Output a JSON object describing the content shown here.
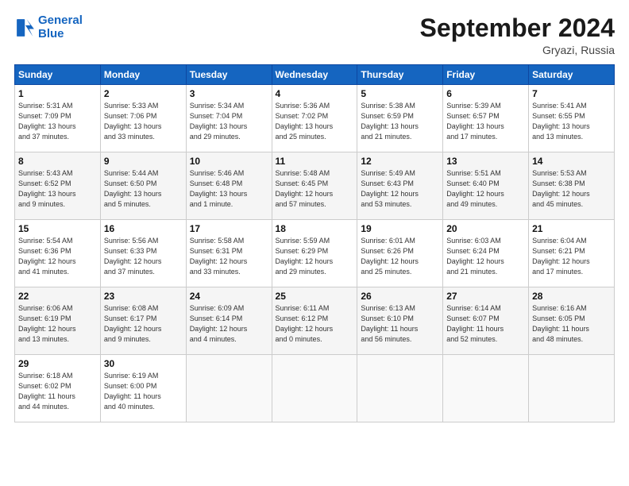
{
  "header": {
    "logo_line1": "General",
    "logo_line2": "Blue",
    "month": "September 2024",
    "location": "Gryazi, Russia"
  },
  "days_of_week": [
    "Sunday",
    "Monday",
    "Tuesday",
    "Wednesday",
    "Thursday",
    "Friday",
    "Saturday"
  ],
  "weeks": [
    [
      {
        "day": "1",
        "info": "Sunrise: 5:31 AM\nSunset: 7:09 PM\nDaylight: 13 hours\nand 37 minutes."
      },
      {
        "day": "2",
        "info": "Sunrise: 5:33 AM\nSunset: 7:06 PM\nDaylight: 13 hours\nand 33 minutes."
      },
      {
        "day": "3",
        "info": "Sunrise: 5:34 AM\nSunset: 7:04 PM\nDaylight: 13 hours\nand 29 minutes."
      },
      {
        "day": "4",
        "info": "Sunrise: 5:36 AM\nSunset: 7:02 PM\nDaylight: 13 hours\nand 25 minutes."
      },
      {
        "day": "5",
        "info": "Sunrise: 5:38 AM\nSunset: 6:59 PM\nDaylight: 13 hours\nand 21 minutes."
      },
      {
        "day": "6",
        "info": "Sunrise: 5:39 AM\nSunset: 6:57 PM\nDaylight: 13 hours\nand 17 minutes."
      },
      {
        "day": "7",
        "info": "Sunrise: 5:41 AM\nSunset: 6:55 PM\nDaylight: 13 hours\nand 13 minutes."
      }
    ],
    [
      {
        "day": "8",
        "info": "Sunrise: 5:43 AM\nSunset: 6:52 PM\nDaylight: 13 hours\nand 9 minutes."
      },
      {
        "day": "9",
        "info": "Sunrise: 5:44 AM\nSunset: 6:50 PM\nDaylight: 13 hours\nand 5 minutes."
      },
      {
        "day": "10",
        "info": "Sunrise: 5:46 AM\nSunset: 6:48 PM\nDaylight: 13 hours\nand 1 minute."
      },
      {
        "day": "11",
        "info": "Sunrise: 5:48 AM\nSunset: 6:45 PM\nDaylight: 12 hours\nand 57 minutes."
      },
      {
        "day": "12",
        "info": "Sunrise: 5:49 AM\nSunset: 6:43 PM\nDaylight: 12 hours\nand 53 minutes."
      },
      {
        "day": "13",
        "info": "Sunrise: 5:51 AM\nSunset: 6:40 PM\nDaylight: 12 hours\nand 49 minutes."
      },
      {
        "day": "14",
        "info": "Sunrise: 5:53 AM\nSunset: 6:38 PM\nDaylight: 12 hours\nand 45 minutes."
      }
    ],
    [
      {
        "day": "15",
        "info": "Sunrise: 5:54 AM\nSunset: 6:36 PM\nDaylight: 12 hours\nand 41 minutes."
      },
      {
        "day": "16",
        "info": "Sunrise: 5:56 AM\nSunset: 6:33 PM\nDaylight: 12 hours\nand 37 minutes."
      },
      {
        "day": "17",
        "info": "Sunrise: 5:58 AM\nSunset: 6:31 PM\nDaylight: 12 hours\nand 33 minutes."
      },
      {
        "day": "18",
        "info": "Sunrise: 5:59 AM\nSunset: 6:29 PM\nDaylight: 12 hours\nand 29 minutes."
      },
      {
        "day": "19",
        "info": "Sunrise: 6:01 AM\nSunset: 6:26 PM\nDaylight: 12 hours\nand 25 minutes."
      },
      {
        "day": "20",
        "info": "Sunrise: 6:03 AM\nSunset: 6:24 PM\nDaylight: 12 hours\nand 21 minutes."
      },
      {
        "day": "21",
        "info": "Sunrise: 6:04 AM\nSunset: 6:21 PM\nDaylight: 12 hours\nand 17 minutes."
      }
    ],
    [
      {
        "day": "22",
        "info": "Sunrise: 6:06 AM\nSunset: 6:19 PM\nDaylight: 12 hours\nand 13 minutes."
      },
      {
        "day": "23",
        "info": "Sunrise: 6:08 AM\nSunset: 6:17 PM\nDaylight: 12 hours\nand 9 minutes."
      },
      {
        "day": "24",
        "info": "Sunrise: 6:09 AM\nSunset: 6:14 PM\nDaylight: 12 hours\nand 4 minutes."
      },
      {
        "day": "25",
        "info": "Sunrise: 6:11 AM\nSunset: 6:12 PM\nDaylight: 12 hours\nand 0 minutes."
      },
      {
        "day": "26",
        "info": "Sunrise: 6:13 AM\nSunset: 6:10 PM\nDaylight: 11 hours\nand 56 minutes."
      },
      {
        "day": "27",
        "info": "Sunrise: 6:14 AM\nSunset: 6:07 PM\nDaylight: 11 hours\nand 52 minutes."
      },
      {
        "day": "28",
        "info": "Sunrise: 6:16 AM\nSunset: 6:05 PM\nDaylight: 11 hours\nand 48 minutes."
      }
    ],
    [
      {
        "day": "29",
        "info": "Sunrise: 6:18 AM\nSunset: 6:02 PM\nDaylight: 11 hours\nand 44 minutes."
      },
      {
        "day": "30",
        "info": "Sunrise: 6:19 AM\nSunset: 6:00 PM\nDaylight: 11 hours\nand 40 minutes."
      },
      {
        "day": "",
        "info": ""
      },
      {
        "day": "",
        "info": ""
      },
      {
        "day": "",
        "info": ""
      },
      {
        "day": "",
        "info": ""
      },
      {
        "day": "",
        "info": ""
      }
    ]
  ]
}
